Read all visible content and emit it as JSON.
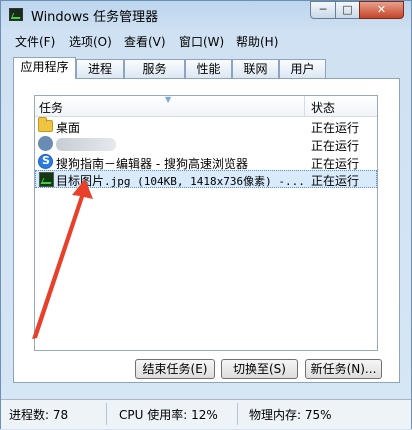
{
  "window": {
    "title": "Windows 任务管理器",
    "controls": {
      "minimize": "─",
      "maximize": "□",
      "close": "✕"
    }
  },
  "menubar": [
    "文件(F)",
    "选项(O)",
    "查看(V)",
    "窗口(W)",
    "帮助(H)"
  ],
  "tabs": [
    "应用程序",
    "进程",
    "服务",
    "性能",
    "联网",
    "用户"
  ],
  "list": {
    "columns": {
      "task": "任务",
      "status": "状态"
    },
    "rows": [
      {
        "name": "桌面",
        "status": "正在运行"
      },
      {
        "name": "",
        "status": "正在运行"
      },
      {
        "name": "搜狗指南－编辑器 - 搜狗高速浏览器",
        "status": "正在运行"
      },
      {
        "name_cn": "目标图片",
        "name_rest": ".jpg (104KB, 1418x736像素) -...",
        "status": "正在运行"
      }
    ]
  },
  "buttons": {
    "end_task": "结束任务(E)",
    "switch_to": "切换至(S)",
    "new_task": "新任务(N)..."
  },
  "statusbar": {
    "processes": "进程数: 78",
    "cpu": "CPU 使用率: 12%",
    "memory": "物理内存: 75%"
  },
  "colors": {
    "annotation_arrow": "#e8402a",
    "selection": "#d9ebfb"
  }
}
